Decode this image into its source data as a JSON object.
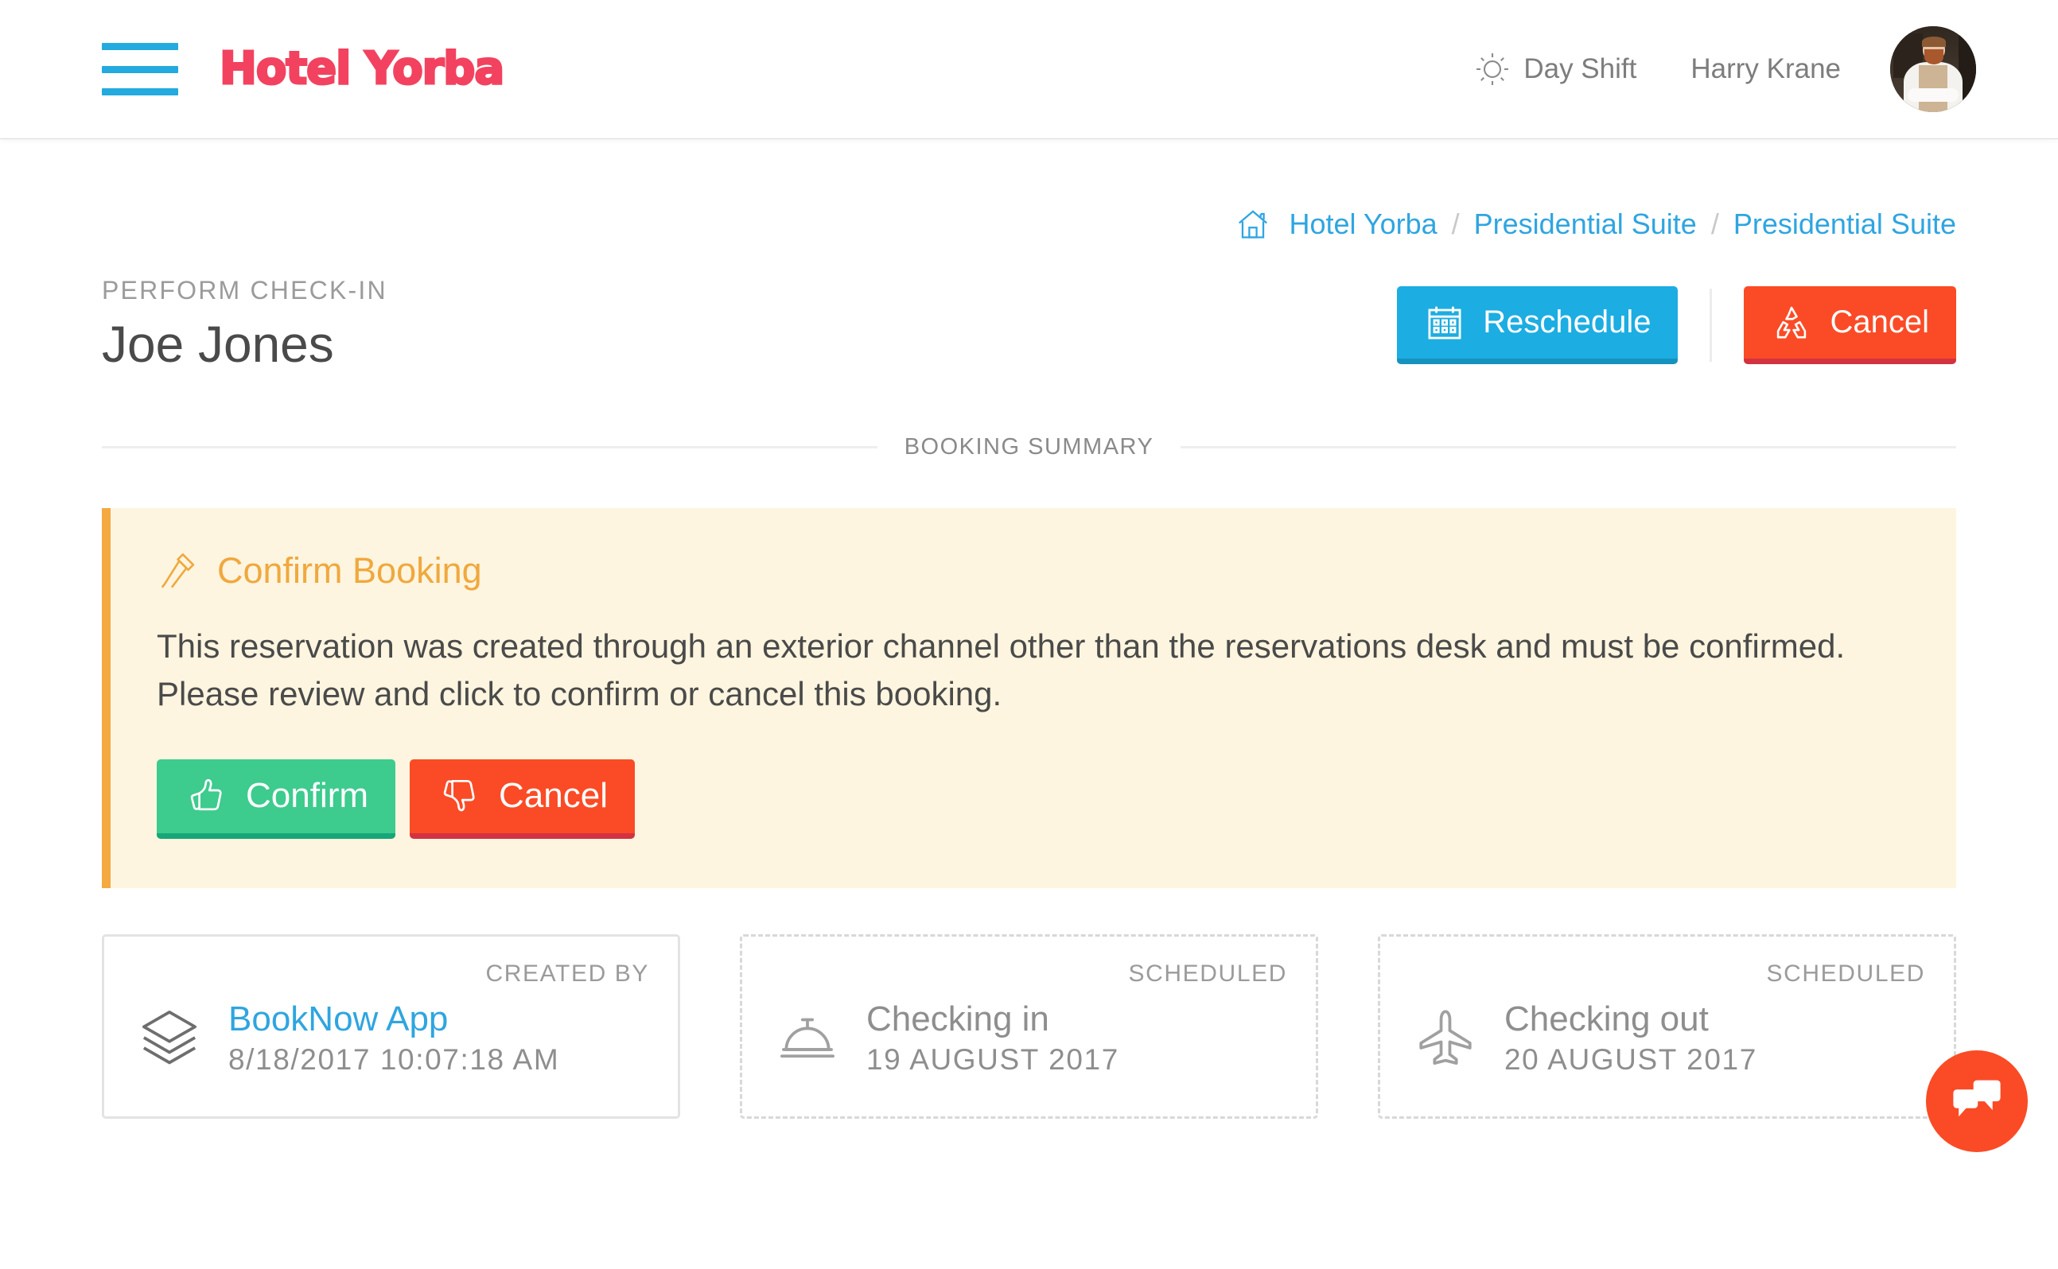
{
  "header": {
    "menu_icon": "hamburger-icon",
    "brand": "Hotel Yorba",
    "shift_icon": "sun-icon",
    "shift_label": "Day Shift",
    "user_name": "Harry Krane",
    "avatar": "user-avatar"
  },
  "breadcrumb": {
    "home_icon": "home-icon",
    "items": [
      {
        "label": "Hotel Yorba"
      },
      {
        "label": "Presidential Suite"
      },
      {
        "label": "Presidential Suite"
      }
    ],
    "separator": "/"
  },
  "page": {
    "eyebrow": "PERFORM CHECK-IN",
    "title": "Joe Jones",
    "actions": {
      "reschedule": {
        "label": "Reschedule",
        "icon": "calendar-icon"
      },
      "cancel": {
        "label": "Cancel",
        "icon": "recycle-icon"
      }
    }
  },
  "section": {
    "booking_summary_label": "BOOKING SUMMARY"
  },
  "alert": {
    "icon": "gavel-icon",
    "heading": "Confirm Booking",
    "body": "This reservation was created through an exterior channel other than the reservations desk and must be confirmed. Please review and click to confirm or cancel this booking.",
    "confirm": {
      "label": "Confirm",
      "icon": "thumbs-up-icon"
    },
    "cancel": {
      "label": "Cancel",
      "icon": "thumbs-down-icon"
    }
  },
  "cards": [
    {
      "label": "CREATED BY",
      "icon": "layers-icon",
      "title": "BookNow App",
      "subtitle": "8/18/2017 10:07:18 AM",
      "style": "solid",
      "title_link": true
    },
    {
      "label": "SCHEDULED",
      "icon": "service-bell-icon",
      "title": "Checking in",
      "subtitle": "19 AUGUST 2017",
      "style": "dashed",
      "title_link": false
    },
    {
      "label": "SCHEDULED",
      "icon": "airplane-icon",
      "title": "Checking out",
      "subtitle": "20 AUGUST 2017",
      "style": "dashed",
      "title_link": false
    }
  ],
  "chat_widget": {
    "icon": "chat-bubbles-icon"
  },
  "colors": {
    "brand_pink": "#F2425F",
    "accent_blue": "#1CADE2",
    "link_blue": "#2FA5E0",
    "danger_red": "#FA4B26",
    "success_green": "#3DCB8E",
    "warning_orange": "#F4A941",
    "alert_bg": "#FDF5DF",
    "text_dark": "#4A4A4A",
    "text_muted": "#8E8E8E"
  }
}
